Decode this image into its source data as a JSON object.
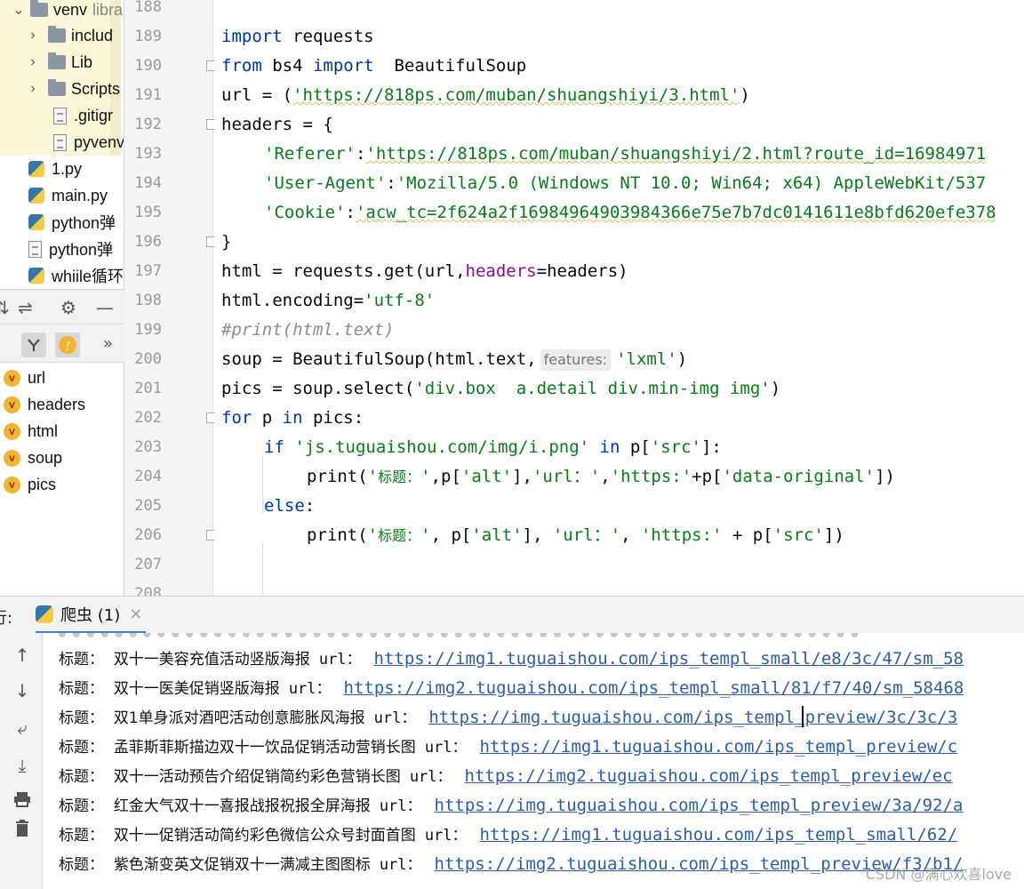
{
  "project_tree": {
    "items": [
      {
        "name": "venv",
        "suffix": "libra",
        "icon": "folder-icon",
        "chevron": "⌄"
      },
      {
        "name": "includ",
        "icon": "folder-icon",
        "chevron": "›"
      },
      {
        "name": "Lib",
        "icon": "folder-icon",
        "chevron": "›"
      },
      {
        "name": "Scripts",
        "icon": "folder-icon",
        "chevron": "›"
      },
      {
        "name": ".gitigr",
        "icon": "gitignore-file-icon"
      },
      {
        "name": "pyvenv",
        "icon": "text-file-icon"
      },
      {
        "name": "1.py",
        "icon": "python-file-icon"
      },
      {
        "name": "main.py",
        "icon": "python-file-icon"
      },
      {
        "name": "python弹",
        "icon": "python-file-icon"
      },
      {
        "name": "python弹",
        "icon": "text-file-icon"
      },
      {
        "name": "whiile循环",
        "icon": "python-file-icon"
      }
    ]
  },
  "structure": {
    "toolbar_icons": [
      "collapse-icon",
      "expand-icon",
      "gear-icon",
      "minimize-icon"
    ],
    "filter_icons": [
      "fields-filter-icon",
      "functions-filter-icon",
      "more-icon"
    ],
    "more": "»",
    "f_label": "f",
    "v_label": "v",
    "variables": [
      "url",
      "headers",
      "html",
      "soup",
      "pics"
    ]
  },
  "editor": {
    "line_numbers": [
      "188",
      "189",
      "190",
      "191",
      "192",
      "193",
      "194",
      "195",
      "196",
      "197",
      "198",
      "199",
      "200",
      "201",
      "202",
      "203",
      "204",
      "205",
      "206",
      "207",
      "208"
    ],
    "code": {
      "l189_kw": "import",
      "l189_rest": " requests",
      "l190_kw1": "from",
      "l190_mid": " bs4 ",
      "l190_kw2": "import",
      "l190_rest": "  BeautifulSoup",
      "l191_a": "url = (",
      "l191_str": "'https://818ps.com/muban/shuangshiyi/3.html'",
      "l191_b": ")",
      "l192": "headers = {",
      "l193_key": "'Referer'",
      "l193_colon": ":",
      "l193_val": "'https://818ps.com/muban/shuangshiyi/2.html?route_id=16984971",
      "l194_key": "'User-Agent'",
      "l194_colon": ":",
      "l194_val": "'Mozilla/5.0 (Windows NT 10.0; Win64; x64) AppleWebKit/537",
      "l195_key": "'Cookie'",
      "l195_colon": ":",
      "l195_val": "'acw_tc=2f624a2f16984964903984366e75e7b7dc0141611e8bfd620efe378",
      "l196": "}",
      "l197_a": "html = requests.get(url,",
      "l197_kwarg": "headers",
      "l197_b": "=headers)",
      "l198_a": "html.encoding=",
      "l198_str": "'utf-8'",
      "l199_cmt": "#print(html.text)",
      "l200_a": "soup = BeautifulSoup(html.text,",
      "l200_hint": "features:",
      "l200_str": "'lxml'",
      "l200_b": ")",
      "l201_a": "pics = soup.select(",
      "l201_str": "'div.box  a.detail div.min-img img'",
      "l201_b": ")",
      "l202_kw1": "for",
      "l202_mid": " p ",
      "l202_kw2": "in",
      "l202_rest": " pics:",
      "l203_kw": "if",
      "l203_str": "'js.tuguaishou.com/img/i.png'",
      "l203_kw2": "in",
      "l203_a": " p[",
      "l203_str2": "'src'",
      "l203_b": "]:",
      "l204_a": "print(",
      "l204_s1": "'",
      "l204_cjk": "标题：",
      "l204_s1e": "'",
      "l204_b": ",p[",
      "l204_s2": "'alt'",
      "l204_c": "],",
      "l204_s3": "'url：'",
      "l204_d": ",",
      "l204_s4": "'https:'",
      "l204_e": "+p[",
      "l204_s5": "'data-original'",
      "l204_f": "])",
      "l205_kw": "else",
      "l205_rest": ":",
      "l206_a": "print(",
      "l206_s1": "'",
      "l206_cjk": "标题：",
      "l206_s1e": "'",
      "l206_b": ", p[",
      "l206_s2": "'alt'",
      "l206_c": "], ",
      "l206_s3": "'url：'",
      "l206_d": ", ",
      "l206_s4": "'https:'",
      "l206_e": " + p[",
      "l206_s5": "'src'",
      "l206_f": "])"
    }
  },
  "run_panel": {
    "label": "行:",
    "tab_title": "爬虫 (1)",
    "close": "×",
    "side_icons": [
      "up-arrow-icon",
      "down-arrow-icon",
      "soft-wrap-icon",
      "scroll-to-end-icon",
      "print-icon",
      "trash-icon"
    ],
    "rows": [
      {
        "title_label": "标题：",
        "title": "双十一美容充值活动竖版海报",
        "url_label": "url：",
        "link": "https://img1.tuguaishou.com/ips_templ_small/e8/3c/47/sm_58"
      },
      {
        "title_label": "标题：",
        "title": "双十一医美促销竖版海报",
        "url_label": "url：",
        "link": "https://img2.tuguaishou.com/ips_templ_small/81/f7/40/sm_58468"
      },
      {
        "title_label": "标题：",
        "title": "双1单身派对酒吧活动创意膨胀风海报",
        "url_label": "url：",
        "link": "https://img.tuguaishou.com/ips_templ_preview/3c/3c/3"
      },
      {
        "title_label": "标题：",
        "title": "孟菲斯菲斯描边双十一饮品促销活动营销长图",
        "url_label": "url：",
        "link": "https://img1.tuguaishou.com/ips_templ_preview/c"
      },
      {
        "title_label": "标题：",
        "title": "双十一活动预告介绍促销简约彩色营销长图",
        "url_label": "url：",
        "link": "https://img2.tuguaishou.com/ips_templ_preview/ec"
      },
      {
        "title_label": "标题：",
        "title": "红金大气双十一喜报战报祝报全屏海报",
        "url_label": "url：",
        "link": "https://img.tuguaishou.com/ips_templ_preview/3a/92/a"
      },
      {
        "title_label": "标题：",
        "title": "双十一促销活动简约彩色微信公众号封面首图",
        "url_label": "url：",
        "link": "https://img1.tuguaishou.com/ips_templ_small/62/"
      },
      {
        "title_label": "标题：",
        "title": "紫色渐变英文促销双十一满减主图图标",
        "url_label": "url：",
        "link": "https://img2.tuguaishou.com/ips_templ_preview/f3/b1/"
      }
    ],
    "watermark": "CSDN @满心欢喜love"
  }
}
